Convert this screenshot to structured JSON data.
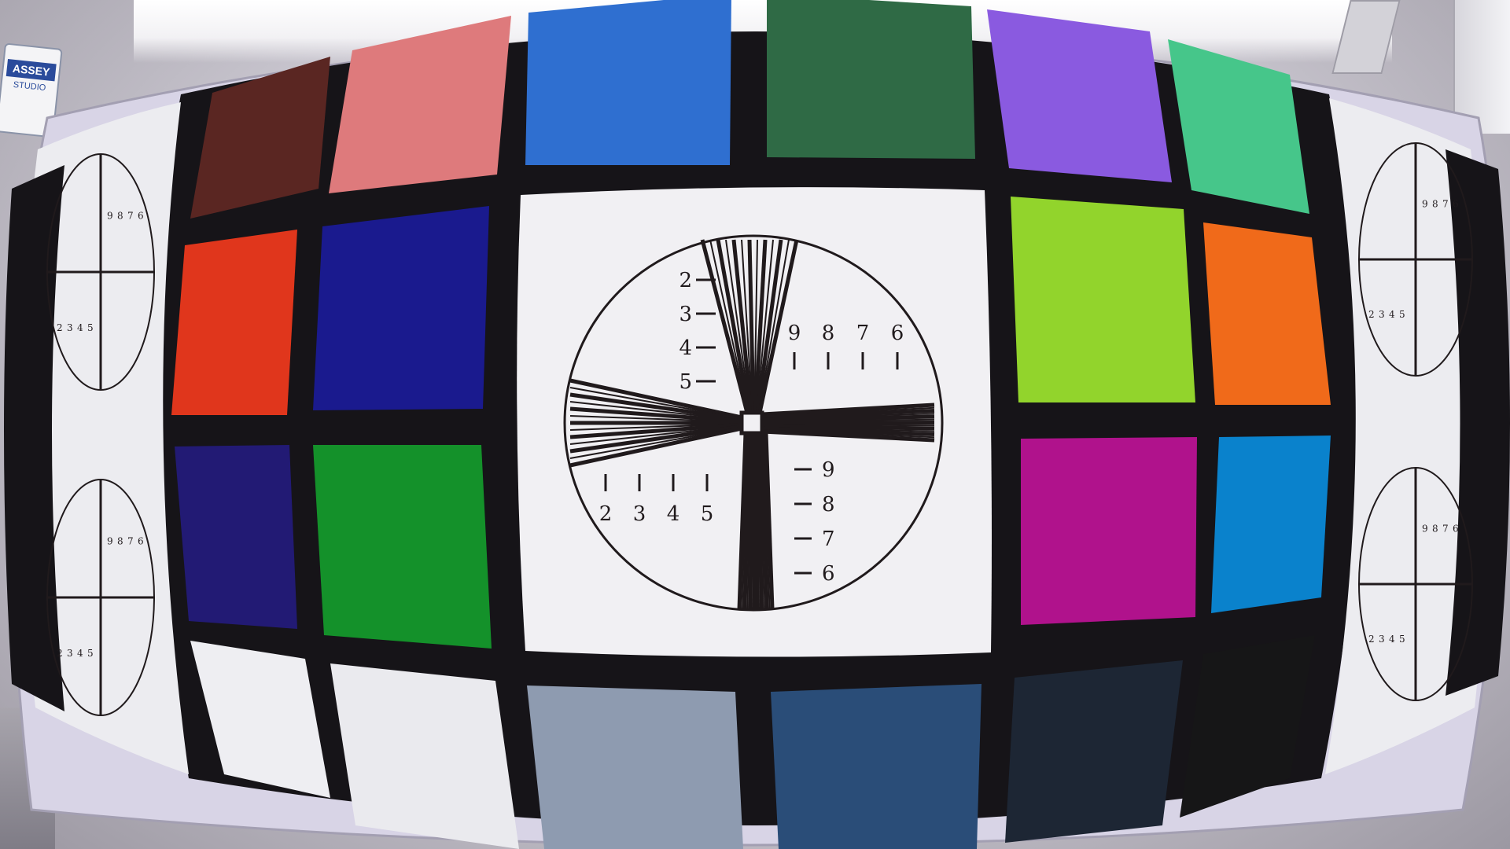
{
  "scene": {
    "sign_text": "ASSEY",
    "sign_subtext": "STUDIO"
  },
  "chart": {
    "center_target": {
      "vertical_scale": [
        "2",
        "3",
        "4",
        "5"
      ],
      "upper_right_digits": [
        "9",
        "8",
        "7",
        "6"
      ],
      "lower_left_digits": [
        "2",
        "3",
        "4",
        "5"
      ],
      "lower_right_scale": [
        "9",
        "8",
        "7",
        "6"
      ]
    },
    "side_target_digits": [
      "9",
      "8",
      "7",
      "6",
      "2",
      "3",
      "4",
      "5"
    ],
    "patch_colors": {
      "top_row": [
        "#5a2622",
        "#de7a7c",
        "#2f6fd0",
        "#2f6a45",
        "#8a5ae0",
        "#46c68a"
      ],
      "left_block": [
        "#e0361c",
        "#1a1a8e",
        "#221a74",
        "#14912a"
      ],
      "right_block": [
        "#92d42c",
        "#f06a1a",
        "#b0128c",
        "#0a82cc"
      ],
      "bottom_row": [
        "#eeeef2",
        "#eaeaee",
        "#8e9bb0",
        "#2a4d78",
        "#1d2634",
        "#161617"
      ]
    }
  }
}
